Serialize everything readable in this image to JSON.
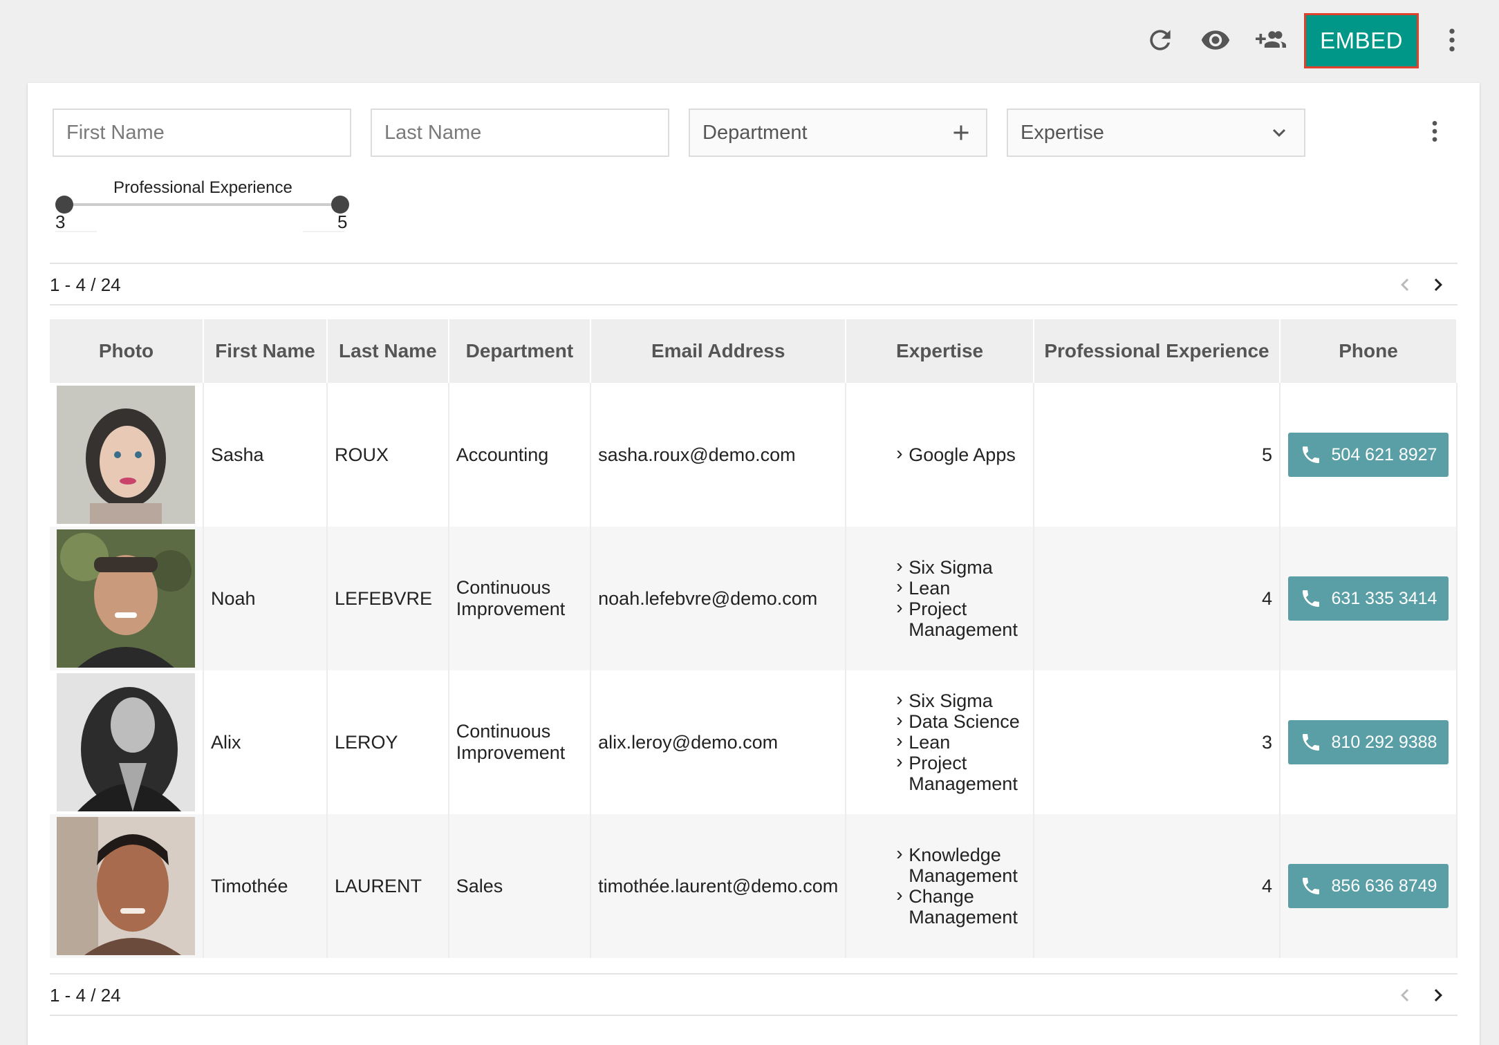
{
  "toolbar": {
    "embed_label": "EMBED",
    "icons": [
      "refresh-icon",
      "eye-icon",
      "add-user-icon",
      "more-vert-icon"
    ]
  },
  "filters": {
    "first_name_placeholder": "First Name",
    "last_name_placeholder": "Last Name",
    "department_label": "Department",
    "expertise_label": "Expertise"
  },
  "slider": {
    "label": "Professional Experience",
    "min": 3,
    "max": 5
  },
  "pager": {
    "range_text": "1 - 4 / 24"
  },
  "table": {
    "headers": [
      "Photo",
      "First Name",
      "Last Name",
      "Department",
      "Email Address",
      "Expertise",
      "Professional Experience",
      "Phone"
    ],
    "rows": [
      {
        "first": "Sasha",
        "last": "ROUX",
        "department": "Accounting",
        "email": "sasha.roux@demo.com",
        "expertise": [
          "Google Apps"
        ],
        "experience": "5",
        "phone": "504 621 8927"
      },
      {
        "first": "Noah",
        "last": "LEFEBVRE",
        "department": "Continuous Improvement",
        "email": "noah.lefebvre@demo.com",
        "expertise": [
          "Six Sigma",
          "Lean",
          "Project Management"
        ],
        "experience": "4",
        "phone": "631 335 3414"
      },
      {
        "first": "Alix",
        "last": "LEROY",
        "department": "Continuous Improvement",
        "email": "alix.leroy@demo.com",
        "expertise": [
          "Six Sigma",
          "Data Science",
          "Lean",
          "Project Management"
        ],
        "experience": "3",
        "phone": "810 292 9388"
      },
      {
        "first": "Timothée",
        "last": "LAURENT",
        "department": "Sales",
        "email": "timothée.laurent@demo.com",
        "expertise": [
          "Knowledge Management",
          "Change Management"
        ],
        "experience": "4",
        "phone": "856 636 8749"
      }
    ]
  },
  "colors": {
    "embed": "#009688",
    "phone_button": "#5a9fa5"
  }
}
